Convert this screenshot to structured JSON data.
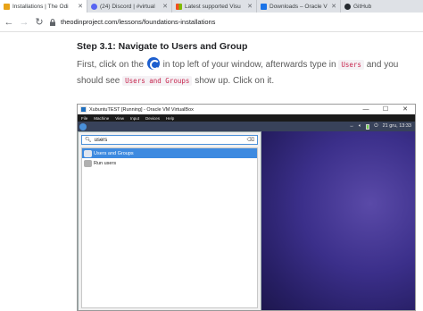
{
  "browser": {
    "tabs": [
      {
        "label": "Installations | The Odi",
        "active": true,
        "favicon_color": "#e8a317"
      },
      {
        "label": "(24) Discord | #virtual",
        "active": false,
        "favicon_color": "#5865f2"
      },
      {
        "label": "Latest supported Visu",
        "active": false,
        "favicon_color": "#f25022"
      },
      {
        "label": "Downloads – Oracle V",
        "active": false,
        "favicon_color": "#1a73e8"
      },
      {
        "label": "GitHub",
        "active": false,
        "favicon_color": "#24292e"
      }
    ],
    "tab_close": "✕",
    "url": "theodinproject.com/lessons/foundations-installations"
  },
  "page": {
    "heading": "Step 3.1: Navigate to Users and Group",
    "para_part1": "First, click on the",
    "para_part2": "in top left of your window, afterwards type in",
    "code_users": "Users",
    "para_part3": "and you should see",
    "code_users_groups": "Users and Groups",
    "para_part4": "show up. Click on it."
  },
  "vm": {
    "title": "XubuntuTEST [Running] - Oracle VM VirtualBox",
    "window_buttons": [
      "—",
      "☐",
      "✕"
    ],
    "menu": [
      "File",
      "Machine",
      "View",
      "Input",
      "Devices",
      "Help"
    ],
    "tray_clock": "21 gru, 13:33",
    "search_value": "users",
    "results": [
      {
        "label": "Users and Groups",
        "selected": true
      },
      {
        "label": "Run users",
        "selected": false
      }
    ]
  }
}
